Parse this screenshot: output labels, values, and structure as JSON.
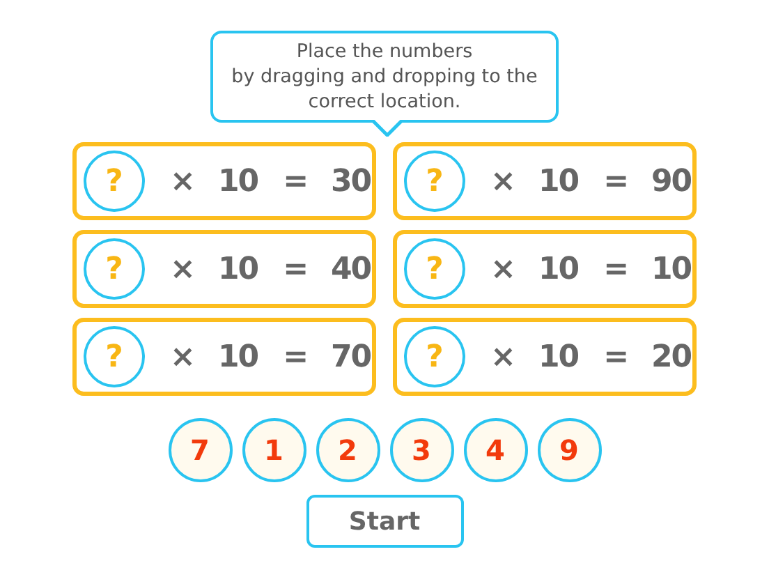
{
  "instruction": {
    "lines": [
      "Place the numbers",
      "by dragging and dropping to the",
      "correct location."
    ]
  },
  "equations": [
    {
      "blank": "?",
      "operator": "×",
      "factor": "10",
      "equals": "=",
      "result": "30"
    },
    {
      "blank": "?",
      "operator": "×",
      "factor": "10",
      "equals": "=",
      "result": "90"
    },
    {
      "blank": "?",
      "operator": "×",
      "factor": "10",
      "equals": "=",
      "result": "40"
    },
    {
      "blank": "?",
      "operator": "×",
      "factor": "10",
      "equals": "=",
      "result": "10"
    },
    {
      "blank": "?",
      "operator": "×",
      "factor": "10",
      "equals": "=",
      "result": "70"
    },
    {
      "blank": "?",
      "operator": "×",
      "factor": "10",
      "equals": "=",
      "result": "20"
    }
  ],
  "number_tiles": [
    "7",
    "1",
    "2",
    "3",
    "4",
    "9"
  ],
  "start_button": "Start"
}
